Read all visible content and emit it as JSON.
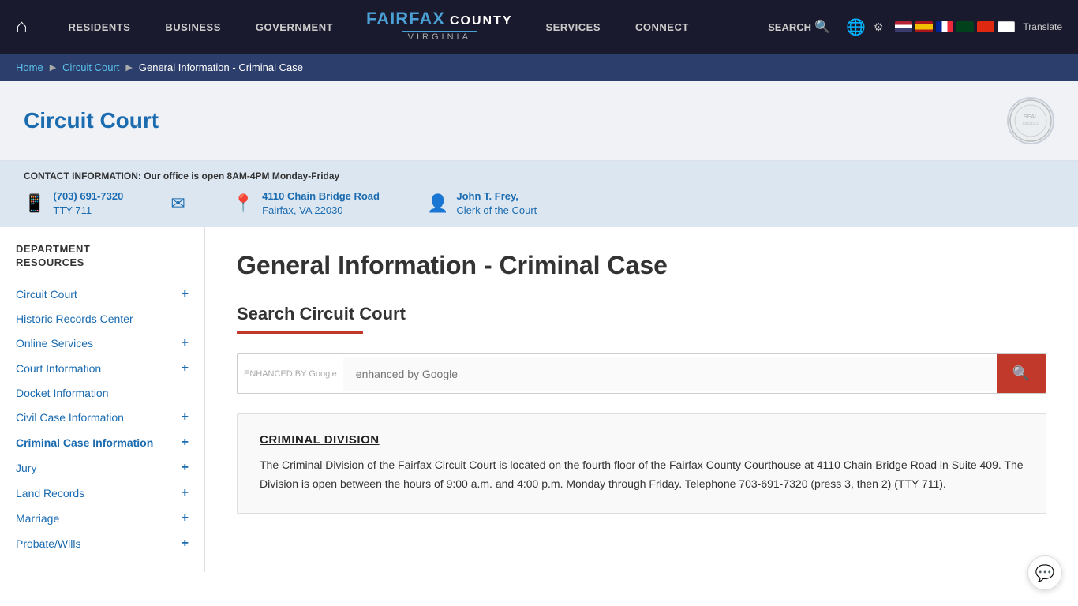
{
  "nav": {
    "home_icon": "⌂",
    "links": [
      {
        "label": "RESIDENTS"
      },
      {
        "label": "BUSINESS"
      },
      {
        "label": "GOVERNMENT"
      },
      {
        "label": "SERVICES"
      },
      {
        "label": "CONNECT"
      }
    ],
    "brand": {
      "name_part1": "FAIRFAX",
      "name_part2": "COUNTY",
      "virginia": "VIRGINIA"
    },
    "search_label": "SEARCH",
    "translate_label": "Translate"
  },
  "breadcrumb": {
    "home": "Home",
    "circuit_court": "Circuit Court",
    "current": "General Information - Criminal Case"
  },
  "page_header": {
    "title": "Circuit Court",
    "seal_label": "SEAL"
  },
  "contact": {
    "note": "CONTACT INFORMATION: Our office is open 8AM-4PM Monday-Friday",
    "phone": "(703) 691-7320",
    "tty": "TTY 711",
    "address_line1": "4110 Chain Bridge Road",
    "address_line2": "Fairfax, VA 22030",
    "clerk": "John T. Frey,",
    "clerk_title": "Clerk of the Court"
  },
  "sidebar": {
    "title": "DEPARTMENT\nRESOURCES",
    "items": [
      {
        "label": "Circuit Court",
        "has_plus": true
      },
      {
        "label": "Historic Records Center",
        "has_plus": false
      },
      {
        "label": "Online Services",
        "has_plus": true
      },
      {
        "label": "Court Information",
        "has_plus": true
      },
      {
        "label": "Docket Information",
        "has_plus": false
      },
      {
        "label": "Civil Case Information",
        "has_plus": true
      },
      {
        "label": "Criminal Case Information",
        "has_plus": true
      },
      {
        "label": "Jury",
        "has_plus": true
      },
      {
        "label": "Land Records",
        "has_plus": true
      },
      {
        "label": "Marriage",
        "has_plus": true
      },
      {
        "label": "Probate/Wills",
        "has_plus": true
      }
    ]
  },
  "content": {
    "page_title": "General Information - Criminal Case",
    "search_section_title": "Search Circuit Court",
    "search_placeholder": "enhanced by Google",
    "search_button_icon": "🔍",
    "criminal_card": {
      "title": "CRIMINAL DIVISION",
      "text": "The Criminal Division of the Fairfax Circuit Court is located on the fourth floor of the Fairfax County Courthouse at 4110 Chain Bridge Road in Suite 409. The Division is open between the hours of 9:00 a.m. and 4:00 p.m. Monday through Friday. Telephone 703-691-7320 (press 3, then 2) (TTY 711)."
    }
  },
  "chat": {
    "icon": "💬"
  }
}
